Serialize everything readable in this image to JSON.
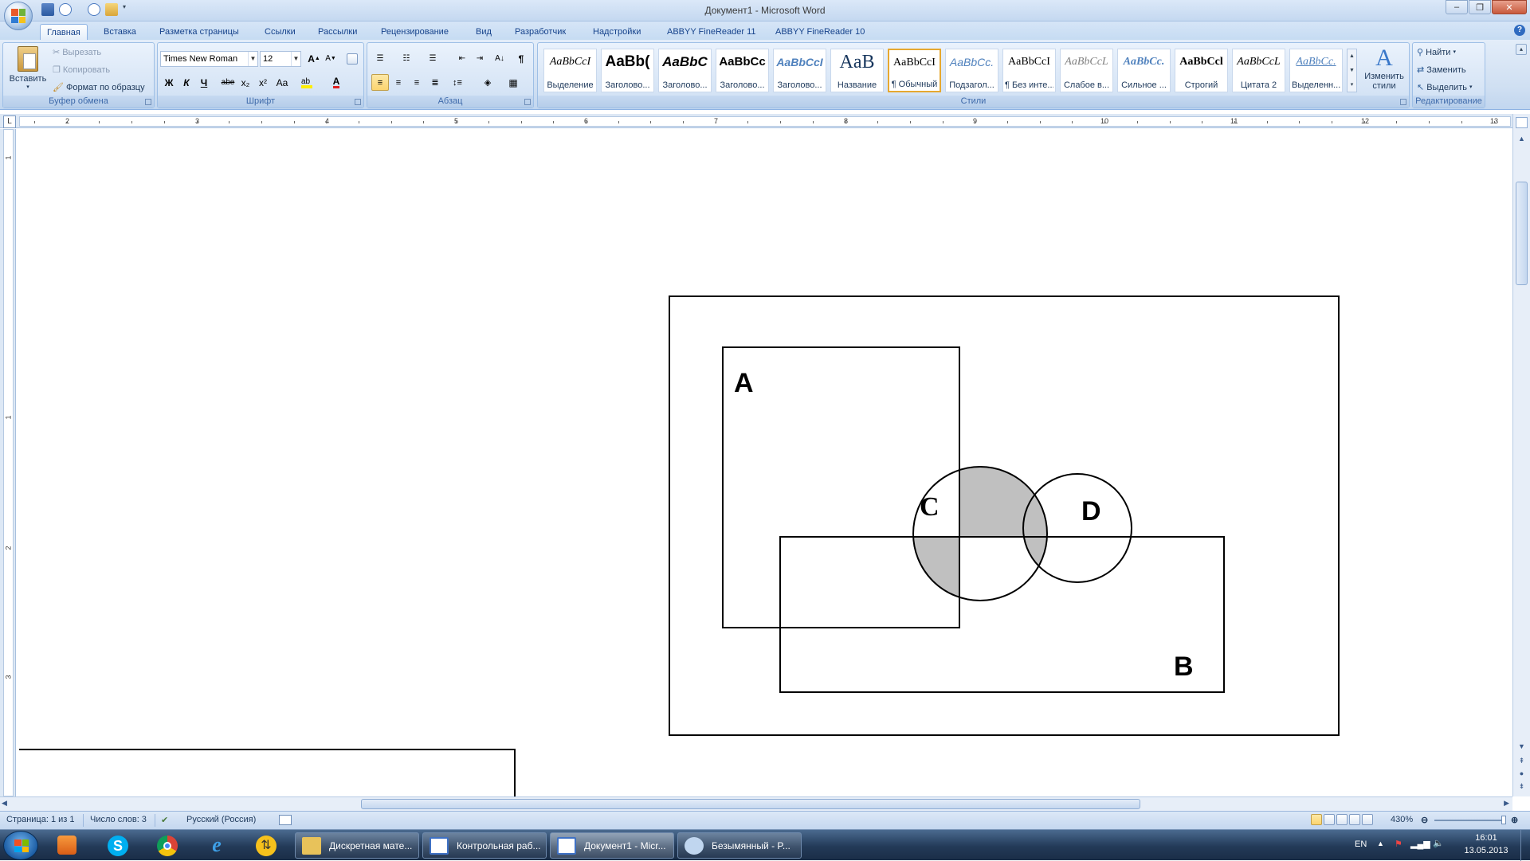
{
  "window": {
    "title": "Документ1 - Microsoft Word",
    "controls": [
      "–",
      "❐",
      "✕"
    ]
  },
  "tabs": [
    "Главная",
    "Вставка",
    "Разметка страницы",
    "Ссылки",
    "Рассылки",
    "Рецензирование",
    "Вид",
    "Разработчик",
    "Надстройки",
    "ABBYY FineReader 11",
    "ABBYY FineReader 10"
  ],
  "clipboard": {
    "paste": "Вставить",
    "cut": "Вырезать",
    "copy": "Копировать",
    "format_painter": "Формат по образцу",
    "label": "Буфер обмена"
  },
  "font": {
    "name": "Times New Roman",
    "size": "12",
    "label": "Шрифт",
    "bold": "Ж",
    "italic": "К",
    "underline": "Ч",
    "strike": "abe",
    "sub": "x₂",
    "sup": "x²",
    "case": "Aa",
    "color_letter": "A",
    "grow": "A",
    "shrink": "A"
  },
  "paragraph": {
    "label": "Абзац",
    "pilcrow": "¶"
  },
  "styles": {
    "label": "Стили",
    "items": [
      {
        "sample": "AaBbCcI",
        "name": "Выделение"
      },
      {
        "sample": "AaBb(",
        "name": "Заголово..."
      },
      {
        "sample": "AaBbC",
        "name": "Заголово..."
      },
      {
        "sample": "AaBbCc",
        "name": "Заголово..."
      },
      {
        "sample": "AaBbCcI",
        "name": "Заголово..."
      },
      {
        "sample": "AaB",
        "name": "Название"
      },
      {
        "sample": "AaBbCcI",
        "name": "¶ Обычный"
      },
      {
        "sample": "AaBbCc.",
        "name": "Подзагол..."
      },
      {
        "sample": "AaBbCcI",
        "name": "¶ Без инте..."
      },
      {
        "sample": "AaBbCcL",
        "name": "Слабое в..."
      },
      {
        "sample": "AaBbCc.",
        "name": "Сильное ..."
      },
      {
        "sample": "AaBbCcl",
        "name": "Строгий"
      },
      {
        "sample": "AaBbCcL",
        "name": "Цитата 2"
      },
      {
        "sample": "AaBbCc.",
        "name": "Выделенн..."
      }
    ],
    "change_styles": "Изменить стили"
  },
  "editing": {
    "find": "Найти",
    "replace": "Заменить",
    "select": "Выделить",
    "label": "Редактирование"
  },
  "ruler": {
    "marks": [
      "2",
      "3",
      "4",
      "5",
      "6",
      "7",
      "8",
      "9",
      "10",
      "11",
      "12",
      "13"
    ],
    "box": "L",
    "vmarks": [
      "1",
      "1",
      "2",
      "3"
    ]
  },
  "diagram": {
    "label_a": "A",
    "label_b": "B",
    "label_c": "C",
    "label_d": "D"
  },
  "status": {
    "page": "Страница: 1 из 1",
    "words": "Число слов: 3",
    "lang": "Русский (Россия)",
    "zoom": "430%"
  },
  "taskbar": {
    "tasks": [
      {
        "label": "Дискретная мате...",
        "color": "#e8c25a"
      },
      {
        "label": "Контрольная раб...",
        "color": "#3f71c4"
      },
      {
        "label": "Документ1 - Micr...",
        "color": "#3f71c4"
      },
      {
        "label": "Безымянный - P...",
        "color": "#c0d6ef"
      }
    ],
    "lang": "EN",
    "time": "16:01",
    "date": "13.05.2013"
  }
}
